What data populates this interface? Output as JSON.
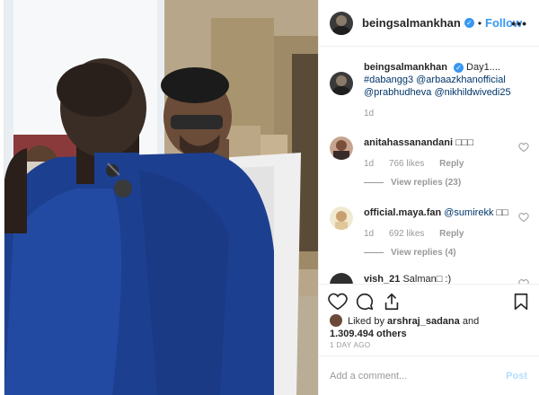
{
  "header": {
    "username": "beingsalmankhan",
    "verified_glyph": "✓",
    "separator": "•",
    "follow_label": "Follow",
    "more_glyph": "•••"
  },
  "caption": {
    "username": "beingsalmankhan",
    "text_start": "Day1....",
    "hashtag": "#dabangg3",
    "mentions": [
      "@arbaazkhanofficial",
      "@prabhudheva",
      "@nikhildwivedi25"
    ],
    "time": "1d"
  },
  "comments": [
    {
      "username": "anitahassanandani",
      "text": "□□□",
      "time": "1d",
      "likes": "766 likes",
      "reply": "Reply",
      "view_replies": "View replies (23)"
    },
    {
      "username": "official.maya.fan",
      "mention": "@sumirekk",
      "text": "□□",
      "time": "1d",
      "likes": "692 likes",
      "reply": "Reply",
      "view_replies": "View replies (4)"
    },
    {
      "username": "vish_21",
      "text": "Salman□ :)"
    }
  ],
  "actions": {
    "liked_by_prefix": "Liked by",
    "liked_by_user": "arshraj_sadana",
    "and": "and",
    "others_count": "1.309.494 others",
    "timestamp": "1 DAY AGO"
  },
  "add_comment": {
    "placeholder": "Add a comment...",
    "post_label": "Post"
  },
  "icons": {
    "like": "heart-icon",
    "comment": "comment-bubble-icon",
    "share": "share-icon",
    "save": "bookmark-icon",
    "more": "more-options-icon"
  },
  "colors": {
    "link_blue": "#3897f0",
    "mention": "#003569",
    "muted": "#999999",
    "text": "#262626"
  }
}
